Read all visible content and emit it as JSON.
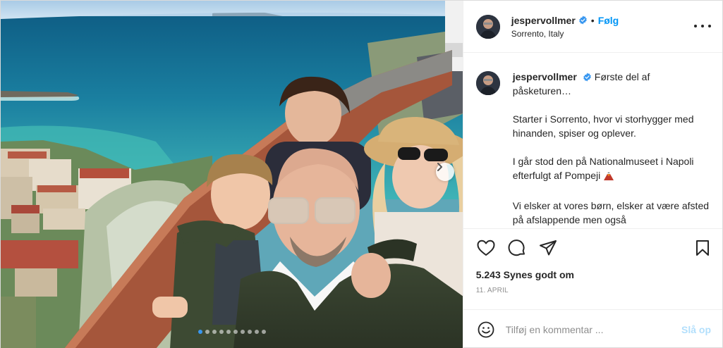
{
  "post": {
    "username": "jespervollmer",
    "follow_label": "Følg",
    "separator": "•",
    "location": "Sorrento, Italy",
    "caption": {
      "line1": "Første del af påsketuren…",
      "p2": "Starter i Sorrento, hvor vi storhygger med hinanden, spiser og oplever.",
      "p3": "I går stod den på Nationalmuseet i Napoli efterfulgt af Pompeji",
      "p4": "Vi elsker at vores børn, elsker at være afsted på afslappende men også"
    },
    "likes": "5.243 Synes godt om",
    "date": "11. APRIL",
    "comment_placeholder": "Tilføj en kommentar ...",
    "post_button": "Slå op",
    "carousel": {
      "total": 10,
      "current": 1
    }
  },
  "icons": {
    "verified": "verified-badge-icon",
    "more": "more-options-icon",
    "like": "heart-icon",
    "comment": "comment-icon",
    "share": "share-icon",
    "save": "bookmark-icon",
    "emoji": "emoji-icon",
    "next": "chevron-right-icon"
  },
  "colors": {
    "accent": "#0095f6",
    "verified": "#3897f0",
    "post_disabled": "#b2dffc",
    "muted": "#8e8e8e"
  }
}
